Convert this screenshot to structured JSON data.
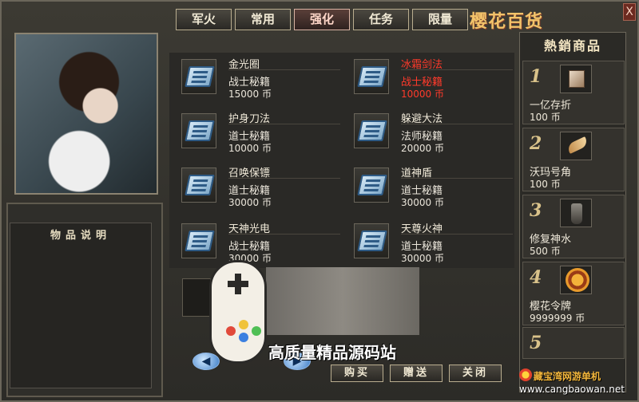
{
  "tabs": [
    "军火",
    "常用",
    "强化",
    "任务",
    "限量"
  ],
  "active_tab_index": 2,
  "brand_title": "樱花百货",
  "close_label": "X",
  "description_panel": {
    "title": "物品说明"
  },
  "items": [
    {
      "name": "金光圈",
      "type": "战士秘籍",
      "price": "15000 币",
      "highlight": false
    },
    {
      "name": "冰霜剑法",
      "type": "战士秘籍",
      "price": "10000 币",
      "highlight": true
    },
    {
      "name": "护身刀法",
      "type": "道士秘籍",
      "price": "10000 币",
      "highlight": false
    },
    {
      "name": "躲避大法",
      "type": "法师秘籍",
      "price": "20000 币",
      "highlight": false
    },
    {
      "name": "召唤保镖",
      "type": "道士秘籍",
      "price": "30000 币",
      "highlight": false
    },
    {
      "name": "道神盾",
      "type": "道士秘籍",
      "price": "30000 币",
      "highlight": false
    },
    {
      "name": "天神光电",
      "type": "战士秘籍",
      "price": "30000 币",
      "highlight": false
    },
    {
      "name": "天尊火神",
      "type": "道士秘籍",
      "price": "30000 币",
      "highlight": false
    }
  ],
  "hot_title": "熱銷商品",
  "hot_items": [
    {
      "rank": "1",
      "name": "一亿存折",
      "price": "100 币",
      "icon": "passbook-icon"
    },
    {
      "rank": "2",
      "name": "沃玛号角",
      "price": "100 币",
      "icon": "horn-icon"
    },
    {
      "rank": "3",
      "name": "修复神水",
      "price": "500 币",
      "icon": "potion-icon"
    },
    {
      "rank": "4",
      "name": "樱花令牌",
      "price": "9999999 币",
      "icon": "token-icon"
    },
    {
      "rank": "5",
      "name": "",
      "price": "",
      "icon": ""
    }
  ],
  "buttons": {
    "buy": "购买",
    "gift": "赠送",
    "close": "关闭"
  },
  "nav": {
    "prev": "◀",
    "next": "▶"
  },
  "watermark": {
    "text": "高质量精品源码站",
    "site_cn": "藏宝湾网游单机",
    "site": "www.cangbaowan.net"
  },
  "colors": {
    "highlight_red": "#ff3a2b",
    "gold": "#f2c36a"
  }
}
